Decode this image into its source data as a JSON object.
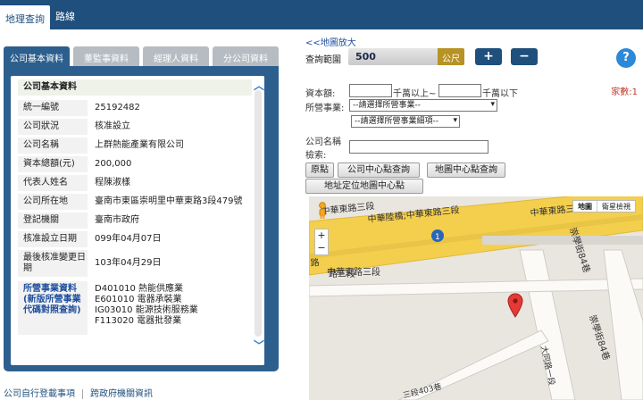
{
  "top": {
    "tabs": [
      "地理查詢",
      "路線"
    ]
  },
  "left": {
    "tabs": [
      "公司基本資料",
      "董監事資料",
      "經理人資料",
      "分公司資料"
    ],
    "section_title": "公司基本資料",
    "rows": [
      {
        "k": "統一編號",
        "v": "25192482"
      },
      {
        "k": "公司狀況",
        "v": "核准設立"
      },
      {
        "k": "公司名稱",
        "v": "上群熱能產業有限公司"
      },
      {
        "k": "資本總額(元)",
        "v": "200,000"
      },
      {
        "k": "代表人姓名",
        "v": "程陳淑樣"
      },
      {
        "k": "公司所在地",
        "v": "臺南市東區崇明里中華東路3段479號"
      },
      {
        "k": "登記機關",
        "v": "臺南市政府"
      },
      {
        "k": "核准設立日期",
        "v": "099年04月07日"
      },
      {
        "k": "最後核准變更日期",
        "v": "103年04月29日"
      }
    ],
    "business_label": "所營事業資料(新版所營事業代碼對照查詢)",
    "business_items": [
      "D401010 熱能供應業",
      "E601010 電器承裝業",
      "IG03010 能源技術服務業",
      "F113020 電器批發業"
    ],
    "footer_links": [
      "公司自行登載事項",
      "跨政府機關資訊"
    ]
  },
  "right": {
    "zoom_link": "<<地圖放大",
    "range_label": "查詢範圍",
    "range_value": "500",
    "range_unit": "公尺",
    "plus": "+",
    "minus": "−",
    "help": "?",
    "capital_label": "資本額:",
    "capital_from_suffix": "千萬以上~",
    "capital_to_suffix": "千萬以下",
    "count_label": "家數:1",
    "business_label": "所營事業:",
    "business_select": "--請選擇所營事業--",
    "business_detail_select": "--請選擇所營事業細項--",
    "name_label": "公司名稱",
    "search_label": "檢索:",
    "buttons": [
      "原點",
      "公司中心點查詢",
      "地圖中心點查詢",
      "地址定位地圖中心點"
    ]
  },
  "map": {
    "map_types": [
      "地圖",
      "衛星檢視"
    ],
    "street_labels": [
      "中華陸橋;中華東路三段",
      "中華東路三段",
      "中華東路三段",
      "路三段",
      "路",
      "崇學街84巷",
      "崇學街84巷",
      "大同路一段",
      "三段403巷"
    ],
    "route_badge": "1",
    "zoom_in": "+",
    "zoom_out": "−"
  },
  "colors": {
    "header": "#1f4f7c",
    "tab_active": "#2d5f8e",
    "unit": "#b79224",
    "count": "#c0392b",
    "road": "#f4cf4d",
    "pin": "#e53935"
  }
}
